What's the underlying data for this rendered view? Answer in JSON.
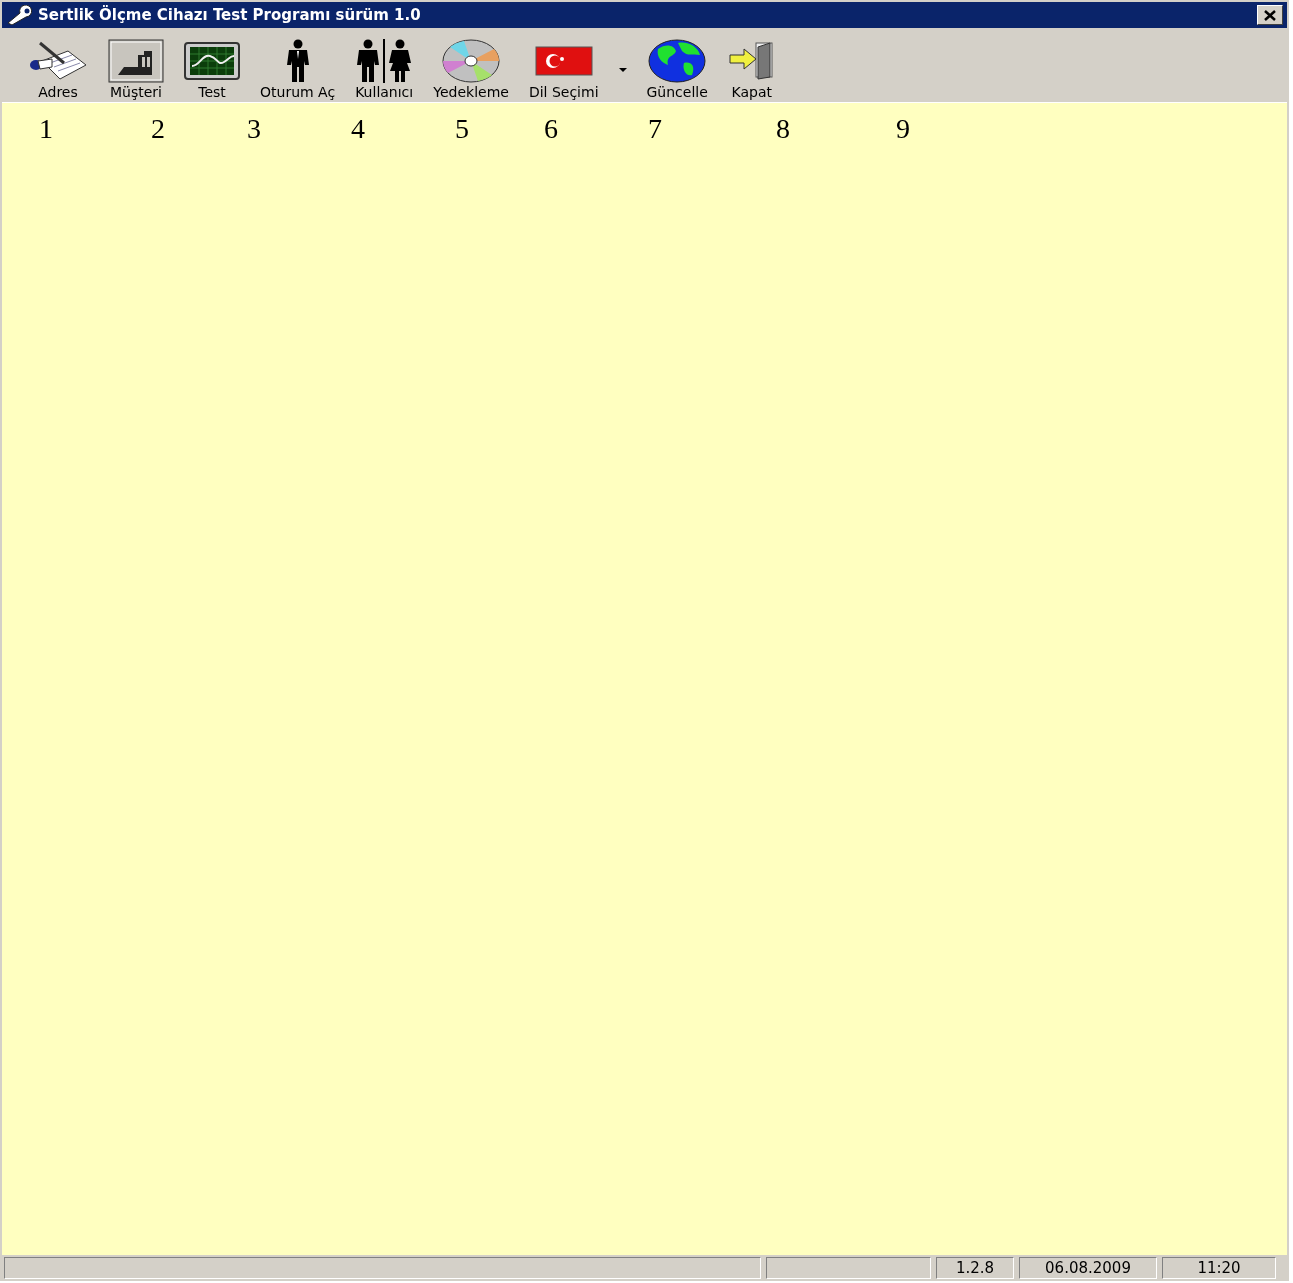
{
  "window": {
    "title": "Sertlik Ölçme Cihazı Test Programı sürüm 1.0"
  },
  "toolbar": [
    {
      "kind": "notepad",
      "label": "Adres"
    },
    {
      "kind": "factory",
      "label": "Müşteri"
    },
    {
      "kind": "monitor",
      "label": "Test"
    },
    {
      "kind": "person",
      "label": "Oturum Aç"
    },
    {
      "kind": "people",
      "label": "Kullanıcı"
    },
    {
      "kind": "disc",
      "label": "Yedekleme"
    },
    {
      "kind": "flag",
      "label": "Dil Seçimi",
      "dropdown": true
    },
    {
      "kind": "globe",
      "label": "Güncelle"
    },
    {
      "kind": "exit",
      "label": "Kapat"
    }
  ],
  "annotations": [
    "1",
    "2",
    "3",
    "4",
    "5",
    "6",
    "7",
    "8",
    "9"
  ],
  "status_bar": {
    "version": "1.2.8",
    "date": "06.08.2009",
    "time": "11:20"
  }
}
